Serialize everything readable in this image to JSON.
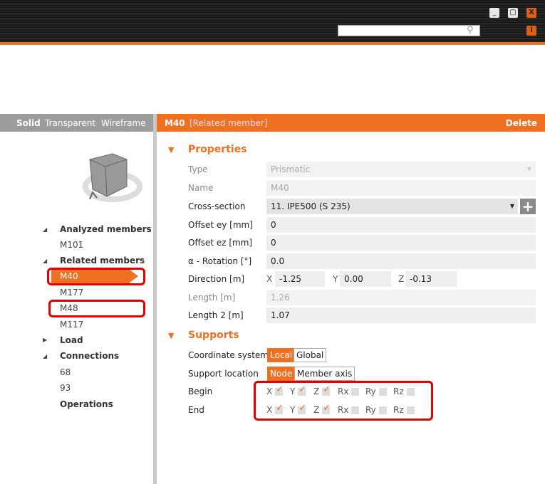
{
  "window": {
    "minimize_icon": "minimize-icon",
    "maximize_icon": "maximize-icon",
    "close_icon": "close-icon",
    "info_icon": "info-icon",
    "search_placeholder": ""
  },
  "view_modes": [
    "Solid",
    "Transparent",
    "Wireframe"
  ],
  "tree": {
    "analyzed_members": "Analyzed members",
    "analyzed": [
      "M101"
    ],
    "related_members": "Related members",
    "related": [
      "M40",
      "M177",
      "M48",
      "M117"
    ],
    "load": "Load",
    "connections": "Connections",
    "connection_items": [
      "68",
      "93"
    ],
    "operations": "Operations"
  },
  "header": {
    "member": "M40",
    "kind": "[Related member]",
    "delete": "Delete"
  },
  "properties": {
    "title": "Properties",
    "type_label": "Type",
    "type_value": "Prismatic",
    "name_label": "Name",
    "name_value": "M40",
    "cross_label": "Cross-section",
    "cross_value": "11. IPE500 (S 235)",
    "ey_label": "Offset ey [mm]",
    "ey_value": "0",
    "ez_label": "Offset ez [mm]",
    "ez_value": "0",
    "rot_label": "α - Rotation [°]",
    "rot_value": "0.0",
    "dir_label": "Direction [m]",
    "dir_x_label": "X",
    "dir_x": "-1.25",
    "dir_y_label": "Y",
    "dir_y": "0.00",
    "dir_z_label": "Z",
    "dir_z": "-0.13",
    "len_label": "Length [m]",
    "len_value": "1.26",
    "len2_label": "Length 2 [m]",
    "len2_value": "1.07"
  },
  "supports": {
    "title": "Supports",
    "coord_label": "Coordinate system",
    "coord_options": [
      "Local",
      "Global"
    ],
    "coord_selected": "Local",
    "loc_label": "Support location",
    "loc_options": [
      "Node",
      "Member axis"
    ],
    "loc_selected": "Node",
    "dof_labels": [
      "X",
      "Y",
      "Z",
      "Rx",
      "Ry",
      "Rz"
    ],
    "begin_label": "Begin",
    "begin": [
      true,
      true,
      true,
      false,
      false,
      false
    ],
    "end_label": "End",
    "end": [
      true,
      true,
      true,
      false,
      false,
      false
    ]
  },
  "colors": {
    "accent": "#f07022",
    "highlight": "#e30000"
  }
}
